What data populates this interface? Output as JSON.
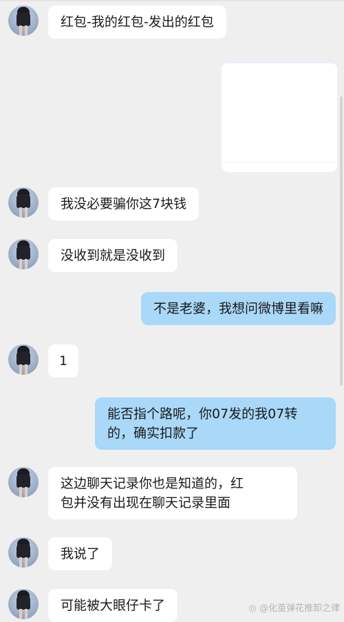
{
  "messages": [
    {
      "side": "in",
      "text": "红包-我的红包-发出的红包"
    },
    {
      "side": "out",
      "type": "image"
    },
    {
      "side": "in",
      "text": "我没必要骗你这7块钱"
    },
    {
      "side": "in",
      "text": "没收到就是没收到"
    },
    {
      "side": "out",
      "text": "不是老婆，我想问微博里看嘛"
    },
    {
      "side": "in",
      "text": "1"
    },
    {
      "side": "out",
      "text": "能否指个路呢，你07发的我07转\n的，确实扣款了"
    },
    {
      "side": "in",
      "text": "这边聊天记录你也是知道的，红\n包并没有出现在聊天记录里面"
    },
    {
      "side": "in",
      "text": "我说了"
    },
    {
      "side": "in",
      "text": "可能被大眼仔卡了"
    }
  ],
  "watermark": "@化茧弹花推卸之律",
  "colors": {
    "background": "#efefef",
    "incoming_bubble": "#ffffff",
    "outgoing_bubble": "#a9d8f8",
    "text": "#1a1a1a"
  },
  "icons": {
    "avatar": "profile-photo-girl",
    "watermark_logo": "weibo-logo"
  }
}
